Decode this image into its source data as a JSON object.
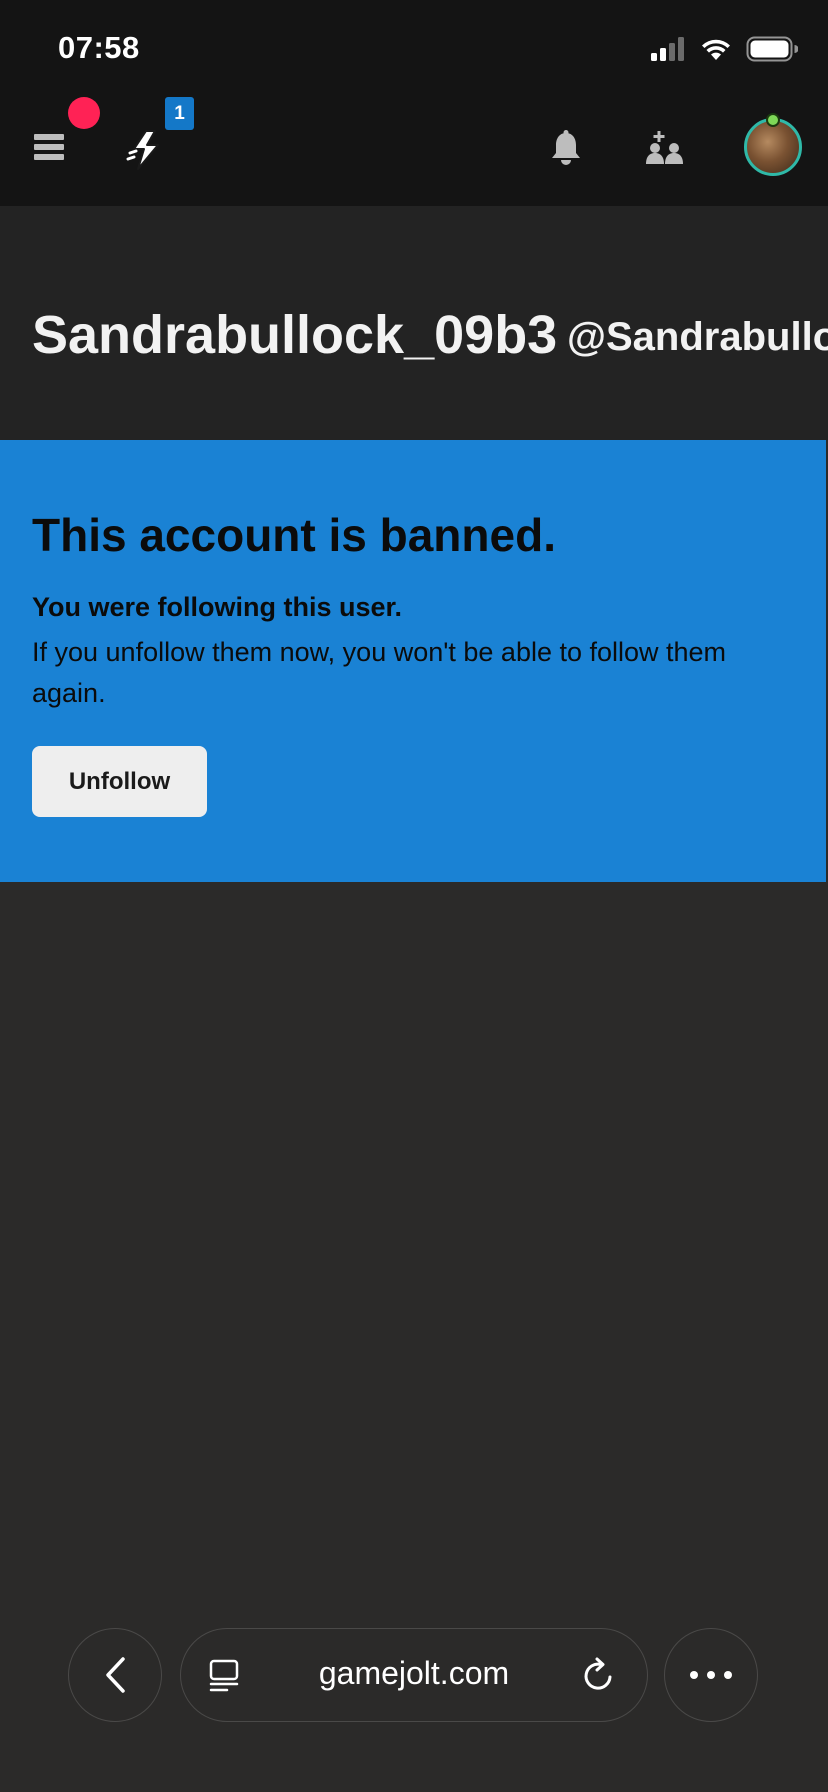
{
  "status_bar": {
    "time": "07:58"
  },
  "top_nav": {
    "activity_badge": "1",
    "icons": [
      "menu-icon",
      "activity-icon",
      "bell-icon",
      "friends-icon",
      "avatar"
    ],
    "colors": {
      "bar_bg": "#141414",
      "notification_dot": "#ff2255",
      "badge_bg": "#1478c8",
      "avatar_ring": "#2fb9a8"
    }
  },
  "profile": {
    "display_name": "Sandrabullock_09b3",
    "handle": "@Sandrabullock"
  },
  "ban_notice": {
    "title": "This account is banned.",
    "subtitle": "You were following this user.",
    "body": "If you unfollow them now, you won't be able to follow them again.",
    "unfollow_label": "Unfollow",
    "panel_color": "#1a82d4"
  },
  "browser": {
    "url": "gamejolt.com"
  }
}
